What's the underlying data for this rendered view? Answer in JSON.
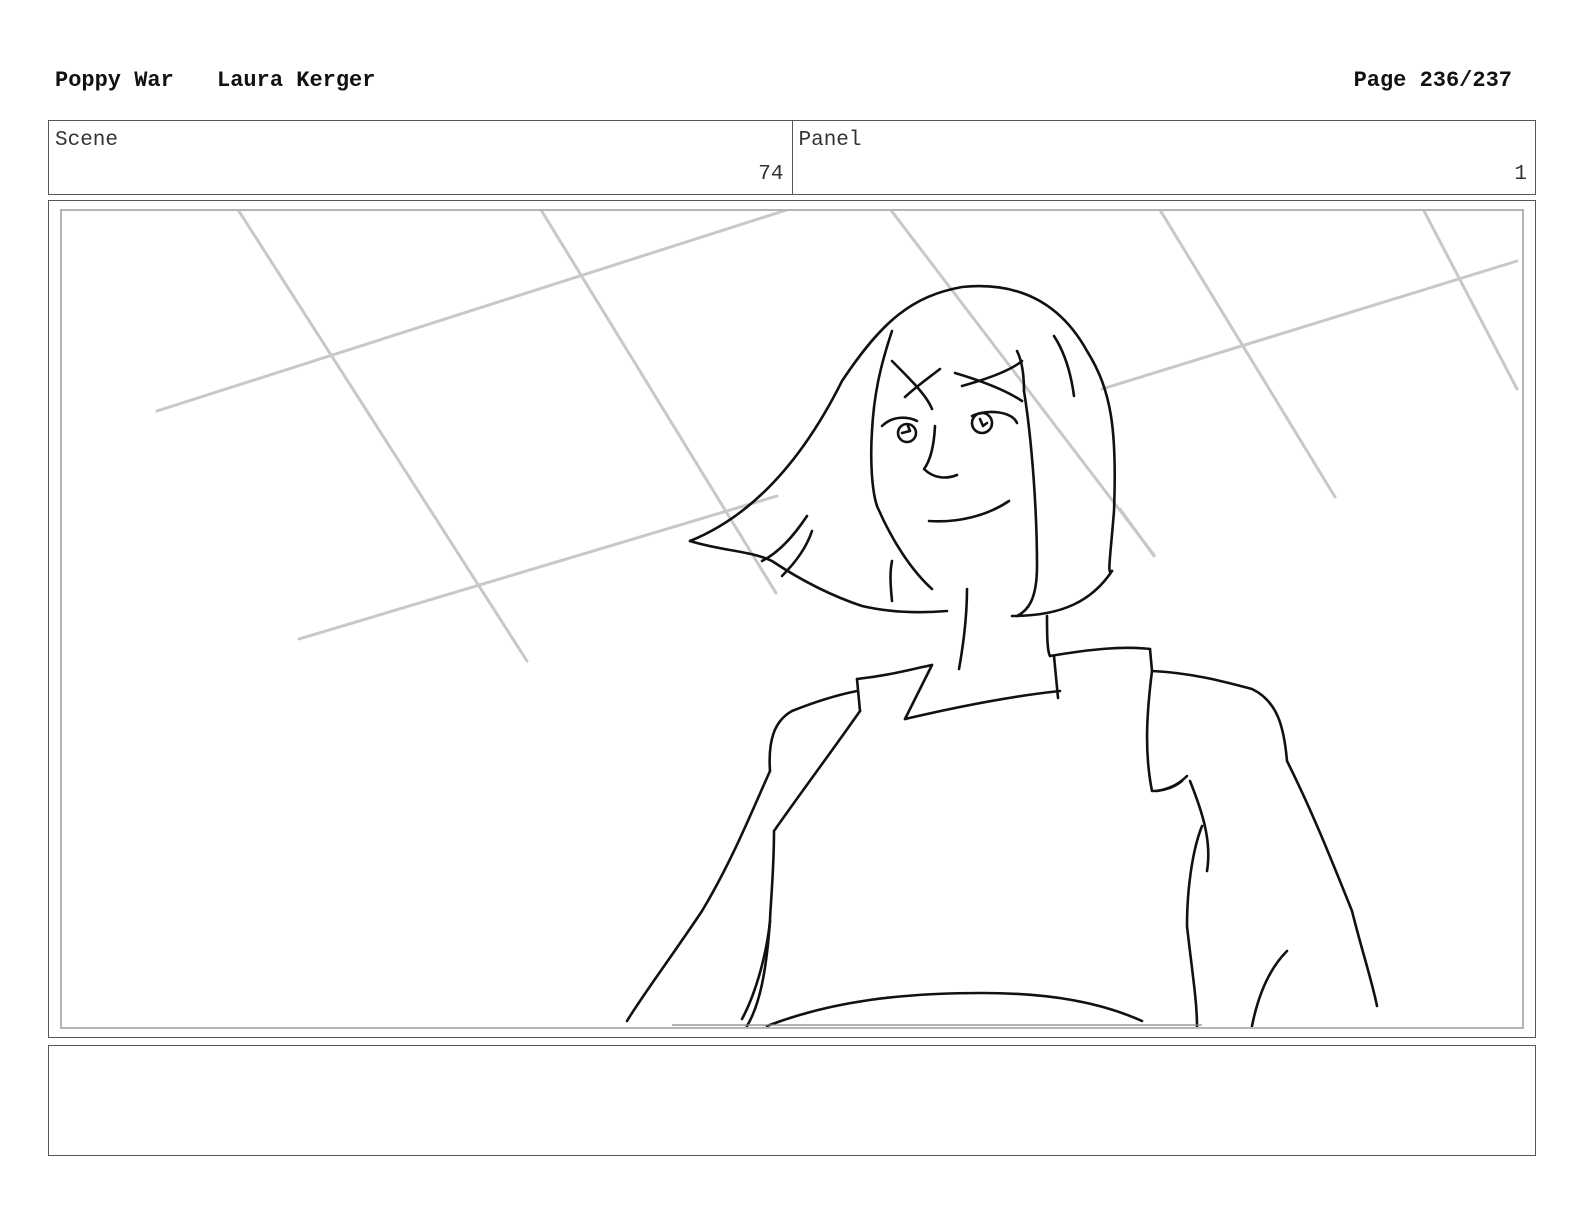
{
  "header": {
    "project_title": "Poppy War",
    "author": "Laura Kerger",
    "page_label": "Page 236/237"
  },
  "scene": {
    "label": "Scene",
    "value": "74"
  },
  "panel": {
    "label": "Panel",
    "value": "1"
  },
  "drawing": {
    "subject": "sketch-drawing",
    "line_color": "#111111",
    "background_line_color": "#c8c8c8"
  },
  "notes": {
    "text": ""
  }
}
